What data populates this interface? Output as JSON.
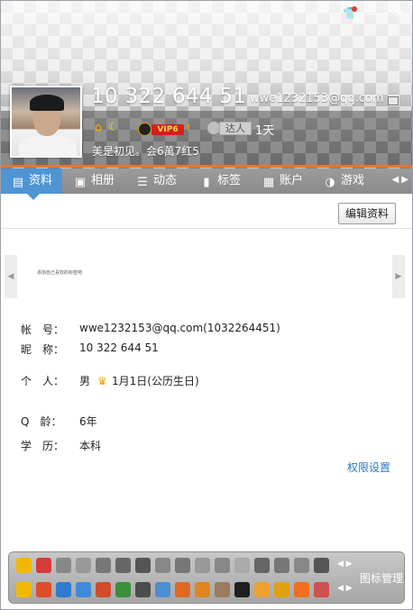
{
  "window": {
    "controls": [
      "skin",
      "minimize",
      "close"
    ]
  },
  "profile": {
    "qq_display": "10 322 644 51",
    "email_display": "wwe1232153@qq.com",
    "level_icons": [
      "house-icon",
      "moon-icon"
    ],
    "vip_label": "VIP6",
    "talent_label": "达人",
    "talent_days": "1天",
    "signature": "美是初见。会6萬7红5"
  },
  "tabs": [
    {
      "label": "资料",
      "icon": "profile-card-icon",
      "active": true
    },
    {
      "label": "相册",
      "icon": "photo-icon",
      "active": false
    },
    {
      "label": "动态",
      "icon": "feed-icon",
      "active": false
    },
    {
      "label": "标签",
      "icon": "bookmark-icon",
      "active": false
    },
    {
      "label": "账户",
      "icon": "wallet-icon",
      "active": false
    },
    {
      "label": "游戏",
      "icon": "game-icon",
      "active": false
    }
  ],
  "toolbar": {
    "edit_label": "编辑资料"
  },
  "carousel": {
    "text": "添加自己喜欢的标签吧"
  },
  "info": {
    "account_key": "帐　号：",
    "account_val": "wwe1232153@qq.com(1032264451)",
    "nick_key": "昵　称：",
    "nick_val": "10 322 644 51",
    "person_key": "个　人：",
    "gender": "男",
    "birthday": "1月1日(公历生日)",
    "qage_key": "Q　龄：",
    "qage_val": "6年",
    "edu_key": "学　历：",
    "edu_val": "本科"
  },
  "links": {
    "permission": "权限设置"
  },
  "icon_panel": {
    "label": "图标管理",
    "row1_colors": [
      "#f2b705",
      "#d63b3b",
      "#888",
      "#999",
      "#777",
      "#666",
      "#555",
      "#888",
      "#777",
      "#999",
      "#888",
      "#aaa",
      "#666",
      "#777",
      "#888",
      "#555"
    ],
    "row2_colors": [
      "#f2b705",
      "#e04b2a",
      "#2f7bd1",
      "#3f8ad8",
      "#d04c2b",
      "#3b8f3b",
      "#4c4c4c",
      "#4a8fd4",
      "#e06a21",
      "#e0861f",
      "#9a7b5b",
      "#1f1f1f",
      "#f0a030",
      "#e0a010",
      "#f07020",
      "#d05050"
    ]
  },
  "colors": {
    "accent": "#4f95d3",
    "orange_line": "#e9762b",
    "link": "#2a78c2"
  }
}
